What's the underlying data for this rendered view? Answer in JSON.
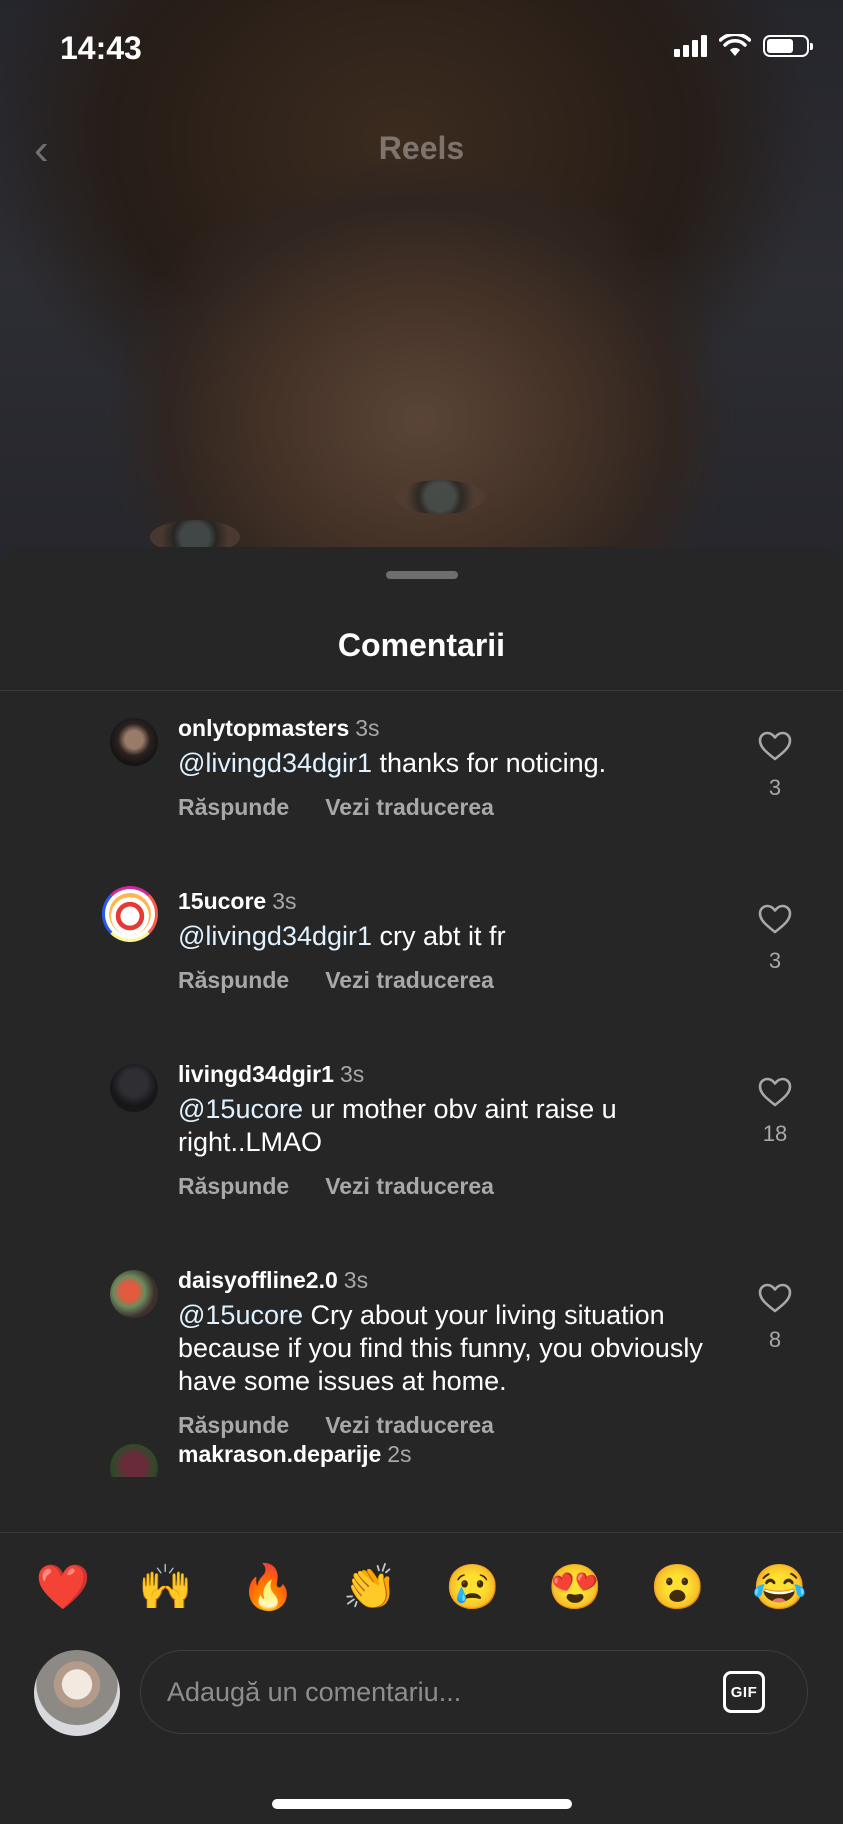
{
  "status_bar": {
    "time": "14:43"
  },
  "reels_header": {
    "title": "Reels"
  },
  "sheet": {
    "title": "Comentarii"
  },
  "comments": [
    {
      "username": "onlytopmasters",
      "time": "3s",
      "mention": "@livingd34dgir1",
      "text": " thanks for noticing.",
      "reply_label": "Răspunde",
      "translate_label": "Vezi traducerea",
      "likes": "3"
    },
    {
      "username": "15ucore",
      "time": "3s",
      "mention": "@livingd34dgir1",
      "text": " cry abt it fr",
      "reply_label": "Răspunde",
      "translate_label": "Vezi traducerea",
      "likes": "3"
    },
    {
      "username": "livingd34dgir1",
      "time": "3s",
      "mention": "@15ucore",
      "text": " ur mother obv aint raise u right..LMAO",
      "reply_label": "Răspunde",
      "translate_label": "Vezi traducerea",
      "likes": "18"
    },
    {
      "username": "daisyoffline2.0",
      "time": "3s",
      "mention": "@15ucore",
      "text": " Cry about your living situation because if you find this funny, you obviously have some issues at home.",
      "reply_label": "Răspunde",
      "translate_label": "Vezi traducerea",
      "likes": "8"
    },
    {
      "username": "makrason.deparije",
      "time": "2s"
    }
  ],
  "emoji_bar": [
    "❤️",
    "🙌",
    "🔥",
    "👏",
    "😢",
    "😍",
    "😮",
    "😂"
  ],
  "composer": {
    "placeholder": "Adaugă un comentariu...",
    "gif_label": "GIF"
  }
}
